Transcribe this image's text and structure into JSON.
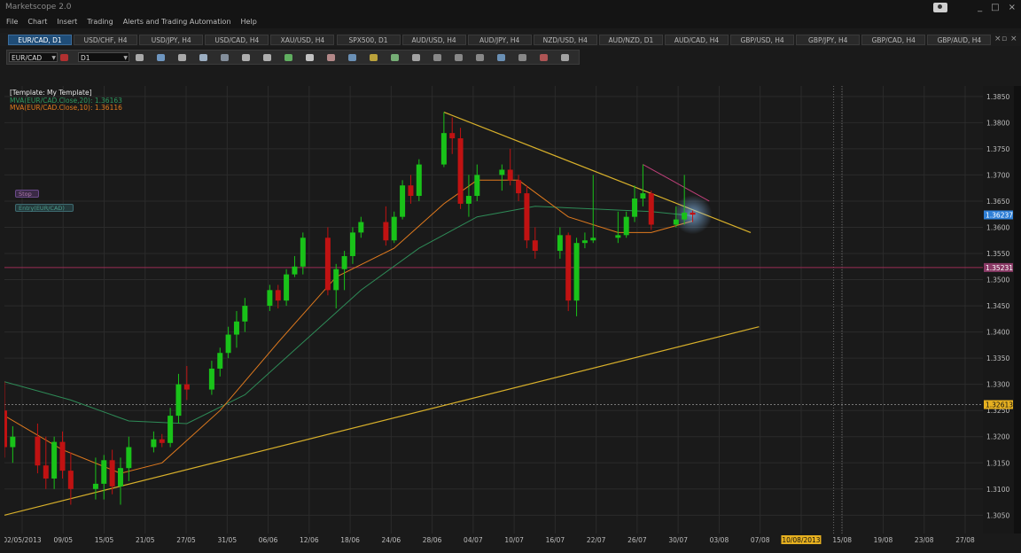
{
  "app": {
    "title": "Marketscope 2.0"
  },
  "menu": [
    "File",
    "Chart",
    "Insert",
    "Trading",
    "Alerts and Trading Automation",
    "Help"
  ],
  "window_controls": [
    "_",
    "□",
    "×"
  ],
  "tabs": [
    {
      "label": "EUR/CAD, D1",
      "active": true
    },
    {
      "label": "USD/CHF, H4",
      "active": false
    },
    {
      "label": "USD/JPY, H4",
      "active": false
    },
    {
      "label": "USD/CAD, H4",
      "active": false
    },
    {
      "label": "XAU/USD, H4",
      "active": false
    },
    {
      "label": "SPX500, D1",
      "active": false
    },
    {
      "label": "AUD/USD, H4",
      "active": false
    },
    {
      "label": "AUD/JPY, H4",
      "active": false
    },
    {
      "label": "NZD/USD, H4",
      "active": false
    },
    {
      "label": "AUD/NZD, D1",
      "active": false
    },
    {
      "label": "AUD/CAD, H4",
      "active": false
    },
    {
      "label": "GBP/USD, H4",
      "active": false
    },
    {
      "label": "GBP/JPY, H4",
      "active": false
    },
    {
      "label": "GBP/CAD, H4",
      "active": false
    },
    {
      "label": "GBP/AUD, H4",
      "active": false
    }
  ],
  "toolbar": {
    "symbol": "EUR/CAD",
    "timeframe": "D1"
  },
  "legend": {
    "template": "[Template: My Template]",
    "mva20": "MVA(EUR/CAD.Close,20): 1.36163",
    "mva10": "MVA(EUR/CAD.Close,10): 1.36116"
  },
  "orders": {
    "stop": "Stop",
    "entry": "Entry(EUR/CAD)"
  },
  "colors": {
    "bull": "#19c219",
    "bear": "#c01212",
    "mva20": "#2e8b57",
    "mva10": "#e07a1e",
    "trendline": "#d8b02a",
    "hline": "#9c2d55",
    "current": "#2f7fd6",
    "grid": "#2b2b2b",
    "background": "#1a1a1a"
  },
  "chart_data": {
    "type": "candlestick",
    "symbol": "EUR/CAD",
    "timeframe": "D1",
    "ylim": [
      1.3015,
      1.387
    ],
    "y_ticks": [
      1.305,
      1.31,
      1.315,
      1.32,
      1.325,
      1.33,
      1.335,
      1.34,
      1.345,
      1.35,
      1.355,
      1.36,
      1.365,
      1.37,
      1.375,
      1.38,
      1.385
    ],
    "x_tick_labels": [
      "02/05/2013",
      "09/05",
      "15/05",
      "21/05",
      "27/05",
      "31/05",
      "06/06",
      "12/06",
      "18/06",
      "24/06",
      "28/06",
      "04/07",
      "10/07",
      "16/07",
      "22/07",
      "26/07",
      "30/07",
      "03/08",
      "07/08",
      "10/08/2013",
      "15/08",
      "19/08",
      "23/08",
      "27/08"
    ],
    "date_range": [
      "2013-05-02",
      "2013-08-28"
    ],
    "candles": [
      {
        "d": "2013-05-02",
        "o": 1.325,
        "h": 1.3305,
        "l": 1.316,
        "c": 1.318
      },
      {
        "d": "2013-05-03",
        "o": 1.318,
        "h": 1.322,
        "l": 1.315,
        "c": 1.32
      },
      {
        "d": "2013-05-06",
        "o": 1.32,
        "h": 1.3225,
        "l": 1.313,
        "c": 1.3145
      },
      {
        "d": "2013-05-07",
        "o": 1.3145,
        "h": 1.32,
        "l": 1.31,
        "c": 1.312
      },
      {
        "d": "2013-05-08",
        "o": 1.312,
        "h": 1.32,
        "l": 1.31,
        "c": 1.319
      },
      {
        "d": "2013-05-09",
        "o": 1.319,
        "h": 1.321,
        "l": 1.312,
        "c": 1.3135
      },
      {
        "d": "2013-05-10",
        "o": 1.3135,
        "h": 1.317,
        "l": 1.307,
        "c": 1.31
      },
      {
        "d": "2013-05-13",
        "o": 1.31,
        "h": 1.316,
        "l": 1.308,
        "c": 1.311
      },
      {
        "d": "2013-05-14",
        "o": 1.311,
        "h": 1.3165,
        "l": 1.308,
        "c": 1.3155
      },
      {
        "d": "2013-05-15",
        "o": 1.3155,
        "h": 1.3175,
        "l": 1.309,
        "c": 1.3105
      },
      {
        "d": "2013-05-16",
        "o": 1.3105,
        "h": 1.316,
        "l": 1.307,
        "c": 1.314
      },
      {
        "d": "2013-05-17",
        "o": 1.314,
        "h": 1.32,
        "l": 1.3115,
        "c": 1.318
      },
      {
        "d": "2013-05-20",
        "o": 1.318,
        "h": 1.321,
        "l": 1.317,
        "c": 1.3195
      },
      {
        "d": "2013-05-21",
        "o": 1.3195,
        "h": 1.3205,
        "l": 1.318,
        "c": 1.3188
      },
      {
        "d": "2013-05-22",
        "o": 1.3188,
        "h": 1.3255,
        "l": 1.318,
        "c": 1.324
      },
      {
        "d": "2013-05-23",
        "o": 1.324,
        "h": 1.332,
        "l": 1.3225,
        "c": 1.33
      },
      {
        "d": "2013-05-24",
        "o": 1.33,
        "h": 1.3335,
        "l": 1.327,
        "c": 1.329
      },
      {
        "d": "2013-05-27",
        "o": 1.329,
        "h": 1.3345,
        "l": 1.328,
        "c": 1.333
      },
      {
        "d": "2013-05-28",
        "o": 1.333,
        "h": 1.337,
        "l": 1.3315,
        "c": 1.336
      },
      {
        "d": "2013-05-29",
        "o": 1.336,
        "h": 1.341,
        "l": 1.335,
        "c": 1.3395
      },
      {
        "d": "2013-05-30",
        "o": 1.3395,
        "h": 1.344,
        "l": 1.337,
        "c": 1.342
      },
      {
        "d": "2013-05-31",
        "o": 1.342,
        "h": 1.3465,
        "l": 1.34,
        "c": 1.345
      },
      {
        "d": "2013-06-03",
        "o": 1.345,
        "h": 1.349,
        "l": 1.344,
        "c": 1.348
      },
      {
        "d": "2013-06-04",
        "o": 1.348,
        "h": 1.349,
        "l": 1.3445,
        "c": 1.346
      },
      {
        "d": "2013-06-05",
        "o": 1.346,
        "h": 1.352,
        "l": 1.345,
        "c": 1.351
      },
      {
        "d": "2013-06-06",
        "o": 1.351,
        "h": 1.3545,
        "l": 1.3505,
        "c": 1.3525
      },
      {
        "d": "2013-06-07",
        "o": 1.3525,
        "h": 1.359,
        "l": 1.351,
        "c": 1.358
      },
      {
        "d": "2013-06-10",
        "o": 1.358,
        "h": 1.36,
        "l": 1.347,
        "c": 1.348
      },
      {
        "d": "2013-06-11",
        "o": 1.348,
        "h": 1.353,
        "l": 1.3445,
        "c": 1.352
      },
      {
        "d": "2013-06-12",
        "o": 1.352,
        "h": 1.3555,
        "l": 1.348,
        "c": 1.3545
      },
      {
        "d": "2013-06-13",
        "o": 1.3545,
        "h": 1.36,
        "l": 1.353,
        "c": 1.359
      },
      {
        "d": "2013-06-14",
        "o": 1.359,
        "h": 1.362,
        "l": 1.358,
        "c": 1.361
      },
      {
        "d": "2013-06-17",
        "o": 1.361,
        "h": 1.364,
        "l": 1.3565,
        "c": 1.3575
      },
      {
        "d": "2013-06-18",
        "o": 1.3575,
        "h": 1.363,
        "l": 1.357,
        "c": 1.362
      },
      {
        "d": "2013-06-19",
        "o": 1.362,
        "h": 1.369,
        "l": 1.3615,
        "c": 1.368
      },
      {
        "d": "2013-06-20",
        "o": 1.368,
        "h": 1.37,
        "l": 1.3645,
        "c": 1.366
      },
      {
        "d": "2013-06-21",
        "o": 1.366,
        "h": 1.373,
        "l": 1.365,
        "c": 1.372
      },
      {
        "d": "2013-06-24",
        "o": 1.372,
        "h": 1.382,
        "l": 1.3715,
        "c": 1.378
      },
      {
        "d": "2013-06-25",
        "o": 1.378,
        "h": 1.381,
        "l": 1.374,
        "c": 1.377
      },
      {
        "d": "2013-06-26",
        "o": 1.377,
        "h": 1.379,
        "l": 1.3635,
        "c": 1.3645
      },
      {
        "d": "2013-06-27",
        "o": 1.3645,
        "h": 1.37,
        "l": 1.362,
        "c": 1.366
      },
      {
        "d": "2013-06-28",
        "o": 1.366,
        "h": 1.372,
        "l": 1.365,
        "c": 1.37
      },
      {
        "d": "2013-07-01",
        "o": 1.37,
        "h": 1.372,
        "l": 1.367,
        "c": 1.371
      },
      {
        "d": "2013-07-02",
        "o": 1.371,
        "h": 1.375,
        "l": 1.368,
        "c": 1.369
      },
      {
        "d": "2013-07-03",
        "o": 1.369,
        "h": 1.37,
        "l": 1.365,
        "c": 1.3665
      },
      {
        "d": "2013-07-04",
        "o": 1.3665,
        "h": 1.368,
        "l": 1.356,
        "c": 1.3575
      },
      {
        "d": "2013-07-05",
        "o": 1.3575,
        "h": 1.36,
        "l": 1.354,
        "c": 1.3555
      },
      {
        "d": "2013-07-08",
        "o": 1.3555,
        "h": 1.36,
        "l": 1.354,
        "c": 1.3585
      },
      {
        "d": "2013-07-09",
        "o": 1.3585,
        "h": 1.359,
        "l": 1.344,
        "c": 1.346
      },
      {
        "d": "2013-07-10",
        "o": 1.346,
        "h": 1.358,
        "l": 1.343,
        "c": 1.357
      },
      {
        "d": "2013-07-11",
        "o": 1.357,
        "h": 1.359,
        "l": 1.356,
        "c": 1.3575
      },
      {
        "d": "2013-07-12",
        "o": 1.3575,
        "h": 1.37,
        "l": 1.357,
        "c": 1.358
      },
      {
        "d": "2013-07-15",
        "o": 1.358,
        "h": 1.363,
        "l": 1.357,
        "c": 1.3585
      },
      {
        "d": "2013-07-16",
        "o": 1.3585,
        "h": 1.363,
        "l": 1.358,
        "c": 1.362
      },
      {
        "d": "2013-07-17",
        "o": 1.362,
        "h": 1.368,
        "l": 1.361,
        "c": 1.3655
      },
      {
        "d": "2013-07-18",
        "o": 1.3655,
        "h": 1.372,
        "l": 1.364,
        "c": 1.3665
      },
      {
        "d": "2013-07-19",
        "o": 1.3665,
        "h": 1.367,
        "l": 1.3595,
        "c": 1.3605
      },
      {
        "d": "2013-07-22",
        "o": 1.3605,
        "h": 1.364,
        "l": 1.36,
        "c": 1.3615
      },
      {
        "d": "2013-07-23",
        "o": 1.3615,
        "h": 1.37,
        "l": 1.3605,
        "c": 1.3628
      },
      {
        "d": "2013-07-24",
        "o": 1.3628,
        "h": 1.3632,
        "l": 1.361,
        "c": 1.3624
      }
    ],
    "series": [
      {
        "name": "MVA(EUR/CAD.Close,20)",
        "points": [
          [
            "2013-05-02",
            1.3305
          ],
          [
            "2013-05-10",
            1.327
          ],
          [
            "2013-05-17",
            1.323
          ],
          [
            "2013-05-24",
            1.3225
          ],
          [
            "2013-05-31",
            1.328
          ],
          [
            "2013-06-07",
            1.338
          ],
          [
            "2013-06-14",
            1.348
          ],
          [
            "2013-06-21",
            1.356
          ],
          [
            "2013-06-28",
            1.362
          ],
          [
            "2013-07-05",
            1.364
          ],
          [
            "2013-07-12",
            1.3635
          ],
          [
            "2013-07-19",
            1.363
          ],
          [
            "2013-07-24",
            1.3622
          ]
        ]
      },
      {
        "name": "MVA(EUR/CAD.Close,10)",
        "points": [
          [
            "2013-05-02",
            1.324
          ],
          [
            "2013-05-09",
            1.3175
          ],
          [
            "2013-05-16",
            1.313
          ],
          [
            "2013-05-21",
            1.315
          ],
          [
            "2013-05-28",
            1.325
          ],
          [
            "2013-06-04",
            1.338
          ],
          [
            "2013-06-11",
            1.3505
          ],
          [
            "2013-06-18",
            1.356
          ],
          [
            "2013-06-24",
            1.3645
          ],
          [
            "2013-06-28",
            1.369
          ],
          [
            "2013-07-03",
            1.369
          ],
          [
            "2013-07-09",
            1.362
          ],
          [
            "2013-07-15",
            1.359
          ],
          [
            "2013-07-19",
            1.359
          ],
          [
            "2013-07-24",
            1.3612
          ]
        ]
      }
    ],
    "trendlines": [
      {
        "from": [
          "2013-05-02",
          1.305
        ],
        "to": [
          "2013-08-01",
          1.341
        ]
      },
      {
        "from": [
          "2013-06-24",
          1.382
        ],
        "to": [
          "2013-07-31",
          1.359
        ]
      },
      {
        "from": [
          "2013-07-18",
          1.372
        ],
        "to": [
          "2013-07-26",
          1.365
        ]
      }
    ],
    "h_levels": [
      {
        "value": 1.35231,
        "label": "1.35231"
      },
      {
        "value": 1.32613,
        "label": "1.32613"
      }
    ],
    "current_price": {
      "value": 1.36237,
      "label": "1.36237"
    },
    "v_lines": [
      "2013-08-10",
      "2013-08-11"
    ]
  }
}
